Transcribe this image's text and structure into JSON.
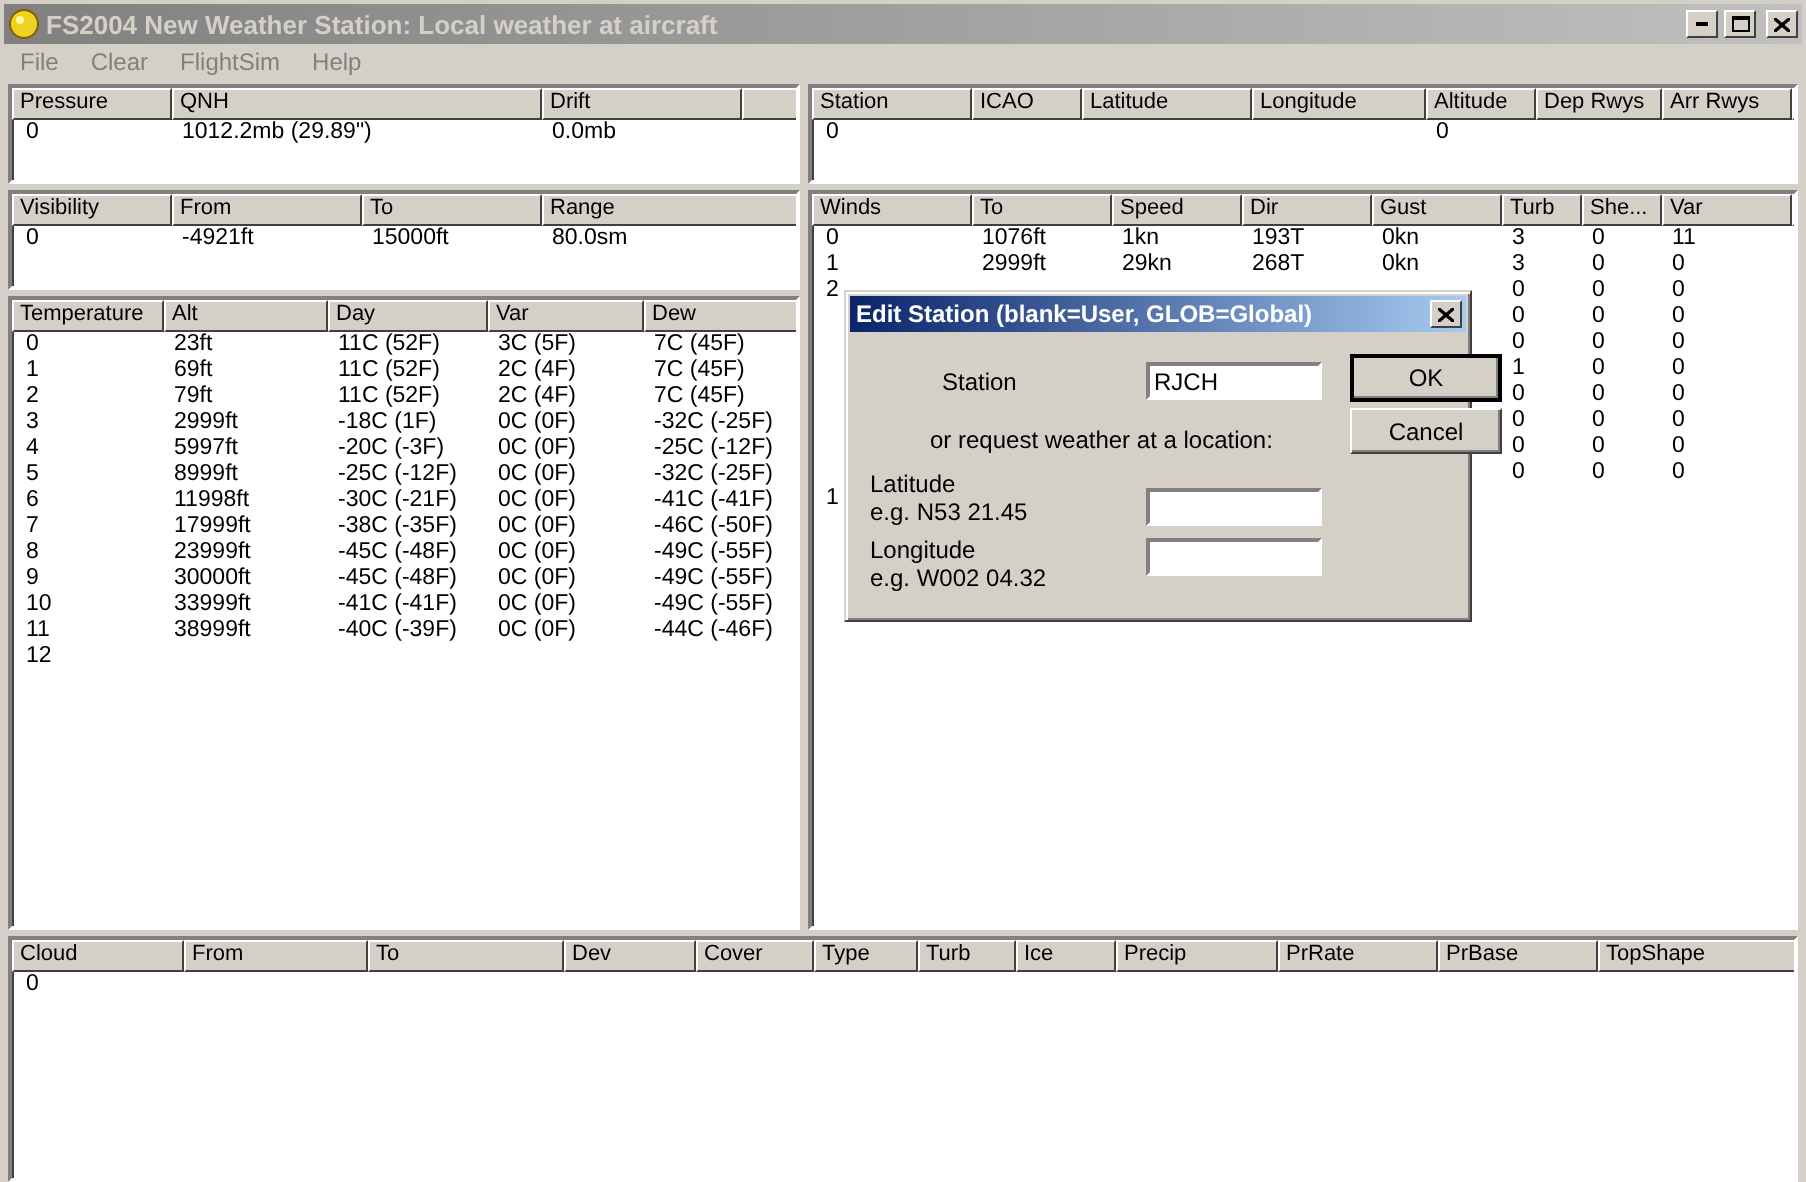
{
  "window": {
    "title": "FS2004 New Weather Station: Local weather at aircraft"
  },
  "menu": [
    {
      "label": "File"
    },
    {
      "label": "Clear"
    },
    {
      "label": "FlightSim"
    },
    {
      "label": "Help"
    }
  ],
  "tables": {
    "pressure": {
      "columns": [
        "Pressure",
        "QNH",
        "Drift",
        null
      ],
      "rows": [
        [
          "0",
          "1012.2mb (29.89\")",
          "0.0mb",
          null
        ]
      ]
    },
    "visibility": {
      "columns": [
        "Visibility",
        "From",
        "To",
        "Range"
      ],
      "rows": [
        [
          "0",
          "-4921ft",
          "15000ft",
          "80.0sm"
        ]
      ]
    },
    "temperature": {
      "columns": [
        "Temperature",
        "Alt",
        "Day",
        "Var",
        "Dew"
      ],
      "rows": [
        [
          "0",
          "23ft",
          "11C (52F)",
          "3C (5F)",
          "7C (45F)"
        ],
        [
          "1",
          "69ft",
          "11C (52F)",
          "2C (4F)",
          "7C (45F)"
        ],
        [
          "2",
          "79ft",
          "11C (52F)",
          "2C (4F)",
          "7C (45F)"
        ],
        [
          "3",
          "2999ft",
          "-18C (1F)",
          "0C (0F)",
          "-32C (-25F)"
        ],
        [
          "4",
          "5997ft",
          "-20C (-3F)",
          "0C (0F)",
          "-25C (-12F)"
        ],
        [
          "5",
          "8999ft",
          "-25C (-12F)",
          "0C (0F)",
          "-32C (-25F)"
        ],
        [
          "6",
          "11998ft",
          "-30C (-21F)",
          "0C (0F)",
          "-41C (-41F)"
        ],
        [
          "7",
          "17999ft",
          "-38C (-35F)",
          "0C (0F)",
          "-46C (-50F)"
        ],
        [
          "8",
          "23999ft",
          "-45C (-48F)",
          "0C (0F)",
          "-49C (-55F)"
        ],
        [
          "9",
          "30000ft",
          "-45C (-48F)",
          "0C (0F)",
          "-49C (-55F)"
        ],
        [
          "10",
          "33999ft",
          "-41C (-41F)",
          "0C (0F)",
          "-49C (-55F)"
        ],
        [
          "11",
          "38999ft",
          "-40C (-39F)",
          "0C (0F)",
          "-44C (-46F)"
        ],
        [
          "12",
          null,
          null,
          null,
          null
        ]
      ]
    },
    "station": {
      "columns": [
        "Station",
        "ICAO",
        "Latitude",
        "Longitude",
        "Altitude",
        "Dep Rwys",
        "Arr Rwys"
      ],
      "rows": [
        [
          "0",
          null,
          null,
          null,
          "0",
          null,
          null
        ]
      ]
    },
    "winds": {
      "columns": [
        "Winds",
        "To",
        "Speed",
        "Dir",
        "Gust",
        "Turb",
        "She...",
        "Var"
      ],
      "rows": [
        [
          "0",
          "1076ft",
          "1kn",
          "193T",
          "0kn",
          "3",
          "0",
          "11"
        ],
        [
          "1",
          "2999ft",
          "29kn",
          "268T",
          "0kn",
          "3",
          "0",
          "0"
        ],
        [
          "2",
          null,
          null,
          null,
          null,
          "0",
          "0",
          "0"
        ],
        [
          null,
          null,
          null,
          null,
          null,
          "0",
          "0",
          "0"
        ],
        [
          null,
          null,
          null,
          null,
          null,
          "0",
          "0",
          "0"
        ],
        [
          null,
          null,
          null,
          null,
          null,
          "1",
          "0",
          "0"
        ],
        [
          null,
          null,
          null,
          null,
          null,
          "0",
          "0",
          "0"
        ],
        [
          null,
          null,
          null,
          null,
          null,
          "0",
          "0",
          "0"
        ],
        [
          null,
          null,
          null,
          null,
          null,
          "0",
          "0",
          "0"
        ],
        [
          null,
          null,
          null,
          null,
          null,
          "0",
          "0",
          "0"
        ],
        [
          "1",
          null,
          null,
          null,
          null,
          null,
          null,
          null
        ]
      ]
    },
    "cloud": {
      "columns": [
        "Cloud",
        "From",
        "To",
        "Dev",
        "Cover",
        "Type",
        "Turb",
        "Ice",
        "Precip",
        "PrRate",
        "PrBase",
        "TopShape"
      ],
      "rows": [
        [
          "0",
          null,
          null,
          null,
          null,
          null,
          null,
          null,
          null,
          null,
          null,
          null
        ]
      ]
    }
  },
  "dialog": {
    "title": "Edit Station (blank=User, GLOB=Global)",
    "station_label": "Station",
    "station_value": "RJCH",
    "note": "or request weather at a location:",
    "latitude_label": "Latitude",
    "latitude_hint": "e.g. N53 21.45",
    "longitude_label": "Longitude",
    "longitude_hint": "e.g. W002 04.32",
    "buttons": [
      {
        "label": "OK",
        "default": true
      },
      {
        "label": "Cancel",
        "default": false
      }
    ]
  }
}
